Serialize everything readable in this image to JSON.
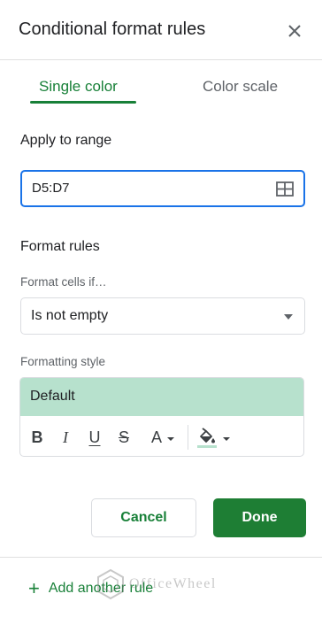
{
  "panel": {
    "title": "Conditional format rules"
  },
  "tabs": [
    {
      "label": "Single color",
      "active": true
    },
    {
      "label": "Color scale",
      "active": false
    }
  ],
  "range": {
    "heading": "Apply to range",
    "value": "D5:D7"
  },
  "rules": {
    "heading": "Format rules",
    "condition_label": "Format cells if…",
    "condition_value": "Is not empty"
  },
  "formatting": {
    "label": "Formatting style",
    "preset": "Default",
    "preview_color": "#b7e1cd",
    "toolbar": {
      "bold": "B",
      "italic": "I",
      "underline": "U",
      "strikethrough": "S",
      "text_color": "A"
    }
  },
  "actions": {
    "cancel": "Cancel",
    "done": "Done"
  },
  "footer": {
    "add_rule_icon": "+",
    "add_rule_label": "Add another rule"
  },
  "watermark": {
    "text": "OfficeWheel"
  },
  "colors": {
    "accent_green": "#188038",
    "done_button": "#1e7e34",
    "focus_blue": "#1a73e8",
    "preview_fill": "#b7e1cd"
  },
  "icons": {
    "close": "close-icon",
    "range_select": "grid-icon",
    "dropdown": "caret-down-icon",
    "fill": "paint-bucket-icon"
  }
}
